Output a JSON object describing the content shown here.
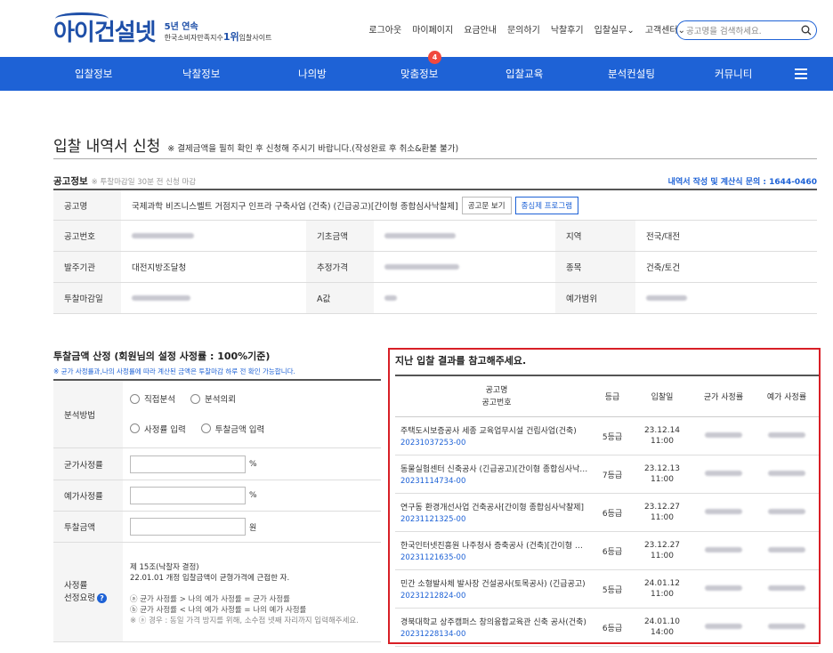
{
  "header": {
    "logo_text": "아이건설넷",
    "logo_sub1": "5년 연속",
    "logo_sub2_pre": "한국소비자만족지수",
    "logo_sub2_rank": "1위",
    "logo_sub2_post": "입찰사이트",
    "top_links": [
      "로그아웃",
      "마이페이지",
      "요금안내",
      "문의하기",
      "낙찰후기",
      "입찰실무⌄",
      "고객센터⌄"
    ],
    "search_placeholder": "공고명을 검색하세요."
  },
  "nav": {
    "items": [
      "입찰정보",
      "낙찰정보",
      "나의방",
      "맞춤정보",
      "입찰교육",
      "분석컨설팅",
      "커뮤니티"
    ],
    "badge": "4"
  },
  "page": {
    "title": "입찰 내역서 신청",
    "notice": "※ 결제금액을 필히 확인 후 신청해 주시기 바랍니다.(작성완료 후 취소&환불 불가)"
  },
  "info": {
    "section_title": "공고정보",
    "section_note": "※ 투찰마감일 30분 전 신청 마감",
    "contact": "내역서 작성 및 계산식 문의 : 1644-0460",
    "name_label": "공고명",
    "name_value": "국제과학 비즈니스벨트 거점지구 인프라 구축사업 (건축) (긴급공고)[간이형 종합심사낙찰제]",
    "btn_view": "공고문 보기",
    "btn_program": "종심제 프로그램",
    "rows": [
      [
        {
          "k": "공고번호",
          "v": ""
        },
        {
          "k": "기초금액",
          "v": ""
        },
        {
          "k": "지역",
          "v": "전국/대전"
        }
      ],
      [
        {
          "k": "발주기관",
          "v": "대전지방조달청"
        },
        {
          "k": "추정가격",
          "v": ""
        },
        {
          "k": "종목",
          "v": "건축/토건"
        }
      ],
      [
        {
          "k": "투찰마감일",
          "v": ""
        },
        {
          "k": "A값",
          "v": ""
        },
        {
          "k": "예가범위",
          "v": ""
        }
      ]
    ]
  },
  "calc": {
    "title": "투찰금액 산정 (회원님의 설정 사정률 : 100%기준)",
    "note": "※ 균가 사정률과,나의 사정률에 따라 계산된 금액은 투찰마감 하루 전 확인 가능합니다.",
    "method_label": "분석방법",
    "radio1": "직접분석",
    "radio2": "분석의뢰",
    "radio3": "사정률 입력",
    "radio4": "투찰금액 입력",
    "avg_label": "균가사정률",
    "exp_label": "예가사정률",
    "amount_label": "투찰금액",
    "unit_pct": "%",
    "unit_won": "원",
    "guide_label1": "사정률",
    "guide_label2": "선정요령",
    "guide_l1": "제 15조(낙찰자 결정)",
    "guide_l2": "22.01.01 개정 입찰금액이 균형가격에 근접한 자.",
    "guide_l3": "ⓐ 균가 사정률 > 나의 예가 사정률 = 균가 사정률",
    "guide_l4": "ⓑ 균가 사정률 < 나의 예가 사정률 = 나의 예가 사정률",
    "guide_l5": "※ ⓐ 경우 : 동일 가격 방지를 위해, 소수점 넷째 자리까지 입력해주세요."
  },
  "history": {
    "title": "지난 입찰 결과를 참고해주세요.",
    "col_name1": "공고명",
    "col_name2": "공고번호",
    "col_grade": "등급",
    "col_date": "입찰일",
    "col_avg": "균가 사정률",
    "col_exp": "예가 사정률",
    "rows": [
      {
        "name": "주택도시보증공사 세종 교육업무시설 건립사업(건축)",
        "no": "20231037253-00",
        "grade": "5등급",
        "date": "23.12.14",
        "time": "11:00"
      },
      {
        "name": "동물실험센터 신축공사 (긴급공고)[간이형 종합심사낙찰제]",
        "no": "20231114734-00",
        "grade": "7등급",
        "date": "23.12.13",
        "time": "11:00"
      },
      {
        "name": "연구동 환경개선사업 건축공사[간이형 종합심사낙찰제]",
        "no": "20231121325-00",
        "grade": "6등급",
        "date": "23.12.27",
        "time": "11:00"
      },
      {
        "name": "한국인터넷진흥원 나주청사 증축공사 (건축)[간이형 종합심사]",
        "no": "20231121635-00",
        "grade": "6등급",
        "date": "23.12.27",
        "time": "11:00"
      },
      {
        "name": "민간 소형발사체 발사장 건설공사(토목공사) (긴급공고)",
        "no": "20231212824-00",
        "grade": "5등급",
        "date": "24.01.12",
        "time": "11:00"
      },
      {
        "name": "경북대학교 상주캠퍼스 창의융합교육관 신축 공사(건축)",
        "no": "20231228134-00",
        "grade": "6등급",
        "date": "24.01.10",
        "time": "14:00"
      }
    ]
  }
}
